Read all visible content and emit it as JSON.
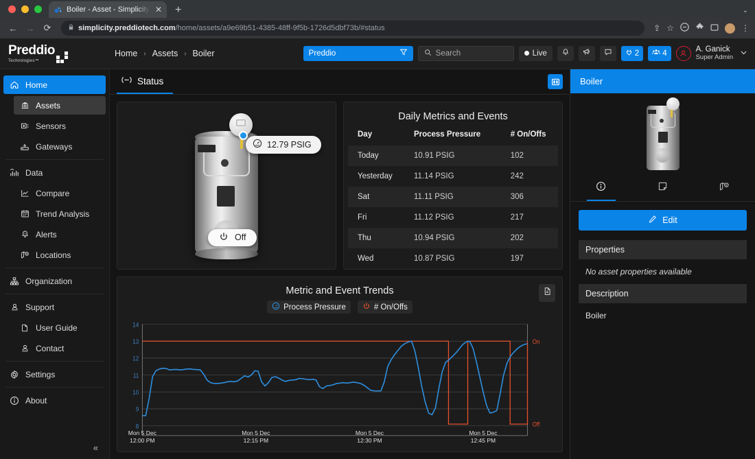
{
  "browser": {
    "tab_title": "Boiler - Asset - Simplicity Clou",
    "tab_close": "✕",
    "new_tab": "+",
    "back": "←",
    "forward": "→",
    "reload": "⟳",
    "lock_icon": "🔒",
    "url_host": "simplicity.preddiotech.com",
    "url_path": "/home/assets/a9e69b51-4385-48ff-9f5b-1726d5dbf73b/#status",
    "share_icon": "⇪",
    "bookmark_icon": "☆",
    "menu_icon": "⋮",
    "window_max_icon": "⌄"
  },
  "header": {
    "logo_text": "Preddio",
    "logo_sub": "Technologies™",
    "breadcrumb": [
      "Home",
      "Assets",
      "Boiler"
    ],
    "breadcrumb_sep": "›",
    "org_filter": {
      "value": "Preddio",
      "icon": "filter-icon"
    },
    "search": {
      "placeholder": "Search",
      "value": ""
    },
    "live_label": "Live",
    "badges": [
      {
        "name": "plug-badge",
        "count": "2"
      },
      {
        "name": "people-badge",
        "count": "4"
      }
    ],
    "user": {
      "name": "A. Ganick",
      "role": "Super Admin"
    }
  },
  "sidebar": {
    "items": [
      {
        "label": "Home",
        "icon": "home-icon",
        "state": "active",
        "level": 0
      },
      {
        "label": "Assets",
        "icon": "bank-icon",
        "state": "selected",
        "level": 1
      },
      {
        "label": "Sensors",
        "icon": "sensor-icon",
        "state": "",
        "level": 1
      },
      {
        "label": "Gateways",
        "icon": "gateway-icon",
        "state": "",
        "level": 1
      },
      {
        "label": "Data",
        "icon": "data-icon",
        "state": "",
        "level": 0
      },
      {
        "label": "Compare",
        "icon": "compare-icon",
        "state": "",
        "level": 1
      },
      {
        "label": "Trend Analysis",
        "icon": "calendar-icon",
        "state": "",
        "level": 1
      },
      {
        "label": "Alerts",
        "icon": "bell-icon",
        "state": "",
        "level": 1
      },
      {
        "label": "Locations",
        "icon": "locations-icon",
        "state": "",
        "level": 1
      },
      {
        "label": "Organization",
        "icon": "org-chart-icon",
        "state": "",
        "level": 0
      },
      {
        "label": "Support",
        "icon": "support-icon",
        "state": "",
        "level": 0
      },
      {
        "label": "User Guide",
        "icon": "document-icon",
        "state": "",
        "level": 1
      },
      {
        "label": "Contact",
        "icon": "contact-icon",
        "state": "",
        "level": 1
      },
      {
        "label": "Settings",
        "icon": "gear-icon",
        "state": "",
        "level": 0
      },
      {
        "label": "About",
        "icon": "info-icon",
        "state": "",
        "level": 0
      }
    ],
    "collapse_icon": "«"
  },
  "main": {
    "tab_label": "Status",
    "tab_icon": "broadcast-icon",
    "panel_toggle_icon": "panel-layout-icon",
    "asset": {
      "sensor_reading": "12.79 PSIG",
      "sensor_icon": "gauge-icon",
      "power_state": "Off",
      "power_icon": "power-icon"
    },
    "metrics": {
      "title": "Daily Metrics and Events",
      "columns": [
        "Day",
        "Process Pressure",
        "# On/Offs"
      ],
      "rows": [
        [
          "Today",
          "10.91 PSIG",
          "102"
        ],
        [
          "Yesterday",
          "11.14 PSIG",
          "242"
        ],
        [
          "Sat",
          "11.11 PSIG",
          "306"
        ],
        [
          "Fri",
          "11.12 PSIG",
          "217"
        ],
        [
          "Thu",
          "10.94 PSIG",
          "202"
        ],
        [
          "Wed",
          "10.87 PSIG",
          "197"
        ]
      ]
    },
    "trends": {
      "title": "Metric and Event Trends",
      "legend": [
        {
          "label": "Process Pressure",
          "icon": "gauge-icon",
          "color": "#2e8fe0"
        },
        {
          "label": "# On/Offs",
          "icon": "power-icon",
          "color": "#e8512b"
        }
      ],
      "export_icon": "export-document-icon"
    }
  },
  "right_panel": {
    "title": "Boiler",
    "tabs": [
      {
        "name": "info-tab",
        "icon": "info-icon",
        "active": true
      },
      {
        "name": "notes-tab",
        "icon": "note-icon",
        "active": false
      },
      {
        "name": "map-tab",
        "icon": "map-icon",
        "active": false
      }
    ],
    "edit_button": "Edit",
    "edit_icon": "pencil-icon",
    "sections": [
      {
        "heading": "Properties",
        "value": "No asset properties available",
        "italic": true
      },
      {
        "heading": "Description",
        "value": "Boiler",
        "italic": false
      }
    ]
  },
  "colors": {
    "accent": "#0b84e8",
    "series_pressure": "#2e8fe0",
    "series_onoff": "#e8512b",
    "bg": "#141414",
    "panel": "#1c1c1c"
  },
  "chart_data": {
    "type": "line",
    "title": "Metric and Event Trends",
    "xlabel": "",
    "ylabel": "",
    "grid": true,
    "legend_position": "top-center",
    "ylim": [
      8,
      14
    ],
    "yticks": [
      8,
      9,
      10,
      11,
      12,
      13,
      14
    ],
    "right_axis_labels": [
      "On",
      "Off"
    ],
    "right_axis_on_value": 13,
    "right_axis_off_value": 8.1,
    "xtick_labels": [
      "Mon 5 Dec\n12:00 PM",
      "Mon 5 Dec\n12:15 PM",
      "Mon 5 Dec\n12:30 PM",
      "Mon 5 Dec\n12:45 PM"
    ],
    "xtick_positions": [
      0,
      0.295,
      0.59,
      0.885
    ],
    "series": [
      {
        "name": "Process Pressure",
        "color": "#2e8fe0",
        "unit": "PSIG",
        "values": [
          8.6,
          8.6,
          9.6,
          10.9,
          11.25,
          11.35,
          11.4,
          11.38,
          11.3,
          11.32,
          11.33,
          11.3,
          11.32,
          11.35,
          11.36,
          11.33,
          11.32,
          11.3,
          11.05,
          10.7,
          10.55,
          10.5,
          10.5,
          10.52,
          10.55,
          10.6,
          10.62,
          10.6,
          10.65,
          10.8,
          10.95,
          10.88,
          11.0,
          11.25,
          11.22,
          10.6,
          10.35,
          10.55,
          10.85,
          10.9,
          10.82,
          10.7,
          10.62,
          10.68,
          10.7,
          10.72,
          10.8,
          10.78,
          10.75,
          10.72,
          10.75,
          10.7,
          10.3,
          10.2,
          10.35,
          10.38,
          10.42,
          10.5,
          10.52,
          10.55,
          10.52,
          10.55,
          10.58,
          10.55,
          10.5,
          10.4,
          10.25,
          10.1,
          10.06,
          10.06,
          10.06,
          10.6,
          11.5,
          11.9,
          12.2,
          12.45,
          12.7,
          12.85,
          12.95,
          13.0,
          12.4,
          11.4,
          10.3,
          9.4,
          8.75,
          8.65,
          9.05,
          10.2,
          11.2,
          11.75,
          11.9,
          12.1,
          12.3,
          12.55,
          12.8,
          12.95,
          13.0,
          12.6,
          11.8,
          10.9,
          10.0,
          9.2,
          8.75,
          8.8,
          8.9,
          9.9,
          11.0,
          11.7,
          12.1,
          12.35,
          12.55,
          12.7,
          12.8,
          12.85
        ]
      },
      {
        "name": "# On/Offs",
        "color": "#e8512b",
        "type": "step",
        "on_value": 13,
        "off_value": 8.1,
        "states": [
          {
            "state": "On",
            "start": 0.0,
            "end": 0.795
          },
          {
            "state": "Off",
            "start": 0.795,
            "end": 0.845
          },
          {
            "state": "On",
            "start": 0.845,
            "end": 0.955
          },
          {
            "state": "Off",
            "start": 0.955,
            "end": 1.02
          },
          {
            "state": "On",
            "start": 1.02,
            "end": 1.0
          }
        ]
      }
    ]
  }
}
